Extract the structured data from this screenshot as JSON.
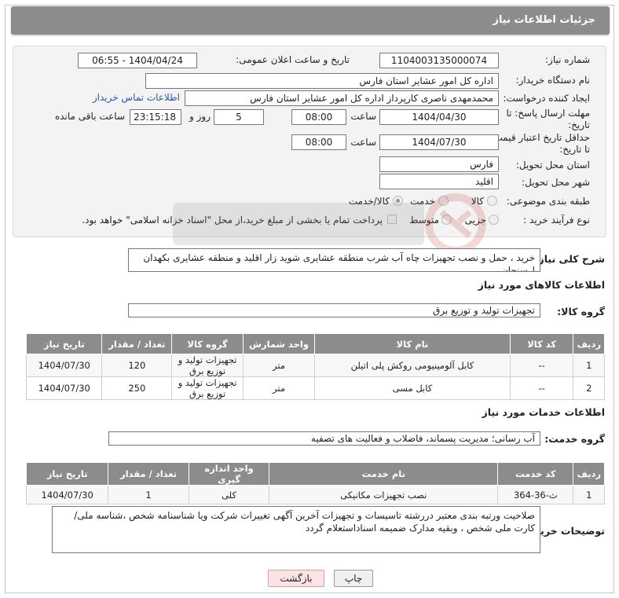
{
  "header": {
    "title": "جزئیات اطلاعات نیاز"
  },
  "form": {
    "need_number_label": "شماره نیاز:",
    "need_number": "1104003135000074",
    "announce_label": "تاریخ و ساعت اعلان عمومی:",
    "announce_value": "1404/04/24 - 06:55",
    "buyer_org_label": "نام دستگاه خریدار:",
    "buyer_org": "اداره کل امور عشایر استان فارس",
    "creator_label": "ایجاد کننده درخواست:",
    "creator": "محمدمهدی ناصری کارپرداز اداره کل امور عشایر استان فارس",
    "contact_link": "اطلاعات تماس خریدار",
    "deadline_label_1": "مهلت ارسال پاسخ: تا",
    "deadline_label_2": "تاریخ:",
    "deadline_date": "1404/04/30",
    "time_label": "ساعت",
    "deadline_time": "08:00",
    "days_value": "5",
    "days_label": "روز و",
    "remaining_time": "23:15:18",
    "remaining_label": "ساعت باقی مانده",
    "price_valid_label_1": "حداقل تاریخ اعتبار قیمت:",
    "price_valid_label_2": "تا تاریخ:",
    "price_valid_date": "1404/07/30",
    "price_valid_time": "08:00",
    "province_label": "استان محل تحویل:",
    "province": "فارس",
    "city_label": "شهر محل تحویل:",
    "city": "اقلید",
    "category_label": "طبقه بندی موضوعی:",
    "category_options": [
      "کالا",
      "خدمت",
      "کالا/خدمت"
    ],
    "purchase_type_label": "نوع فرآیند خرید :",
    "purchase_options": [
      "جزیی",
      "متوسط"
    ],
    "payment_note": "پرداخت تمام یا بخشی از مبلغ خرید،از محل \"اسناد خزانه اسلامی\" خواهد بود."
  },
  "summary": {
    "label": "شرح کلی نیاز:",
    "text": "خرید ، حمل و نصب تجهیزات چاه آب شرب منطقه عشایری شوید زار اقلید و منطقه عشایری بکهدان ارسنجان"
  },
  "goods": {
    "section_title": "اطلاعات کالاهای مورد نیاز",
    "group_label": "گروه کالا:",
    "group_value": "تجهیزات تولید و توزیع برق",
    "columns": [
      "ردیف",
      "کد کالا",
      "نام کالا",
      "واحد شمارش",
      "گروه کالا",
      "تعداد / مقدار",
      "تاریخ نیاز"
    ],
    "rows": [
      [
        "1",
        "--",
        "کابل آلومینیومی روکش پلی اتیلن",
        "متر",
        "تجهیزات تولید و توزیع برق",
        "120",
        "1404/07/30"
      ],
      [
        "2",
        "--",
        "کابل مسی",
        "متر",
        "تجهیزات تولید و توزیع برق",
        "250",
        "1404/07/30"
      ]
    ]
  },
  "services": {
    "section_title": "اطلاعات خدمات مورد نیاز",
    "group_label": "گروه خدمت:",
    "group_value": "آب رسانی؛ مدیریت پسماند، فاضلاب و فعالیت های تصفیه",
    "columns": [
      "ردیف",
      "کد خدمت",
      "نام خدمت",
      "واحد اندازه گیری",
      "تعداد / مقدار",
      "تاریخ نیاز"
    ],
    "rows": [
      [
        "1",
        "ث-36-364",
        "نصب تجهیزات مکانیکی",
        "کلی",
        "1",
        "1404/07/30"
      ]
    ]
  },
  "buyer_notes": {
    "label": "توضیحات خریدار:",
    "text": "صلاحیت ورتبه بندی معتبر دررشته تاسیسات و تجهیزات  آخرین آگهی تغییرات شرکت ویا شناسنامه شخص ،شناسه ملی/کارت ملی شخص ، وبقیه مدارک  ضمیمه اسناداستعلام گردد"
  },
  "buttons": {
    "print": "چاپ",
    "back": "بازگشت"
  },
  "colors": {
    "header_bg": "#8c8c8c",
    "link": "#2a55a8",
    "back_button_bg": "#fde3e3"
  }
}
